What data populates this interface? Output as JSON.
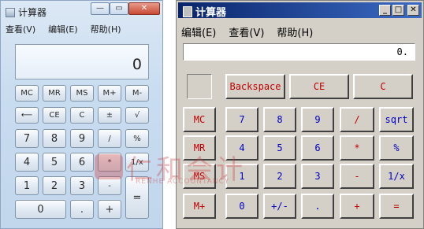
{
  "win7": {
    "title": "计算器",
    "controls": {
      "minimize": "—",
      "maximize": "▭",
      "close": "✕"
    },
    "menu": [
      "查看(V)",
      "编辑(E)",
      "帮助(H)"
    ],
    "display": "0",
    "buttons": [
      [
        "MC",
        "MR",
        "MS",
        "M+",
        "M-"
      ],
      [
        "⟵",
        "CE",
        "C",
        "±",
        "√"
      ],
      [
        "7",
        "8",
        "9",
        "/",
        "%"
      ],
      [
        "4",
        "5",
        "6",
        "*",
        "1/x"
      ],
      [
        "1",
        "2",
        "3",
        "-",
        "="
      ],
      [
        "0",
        ".",
        "+"
      ]
    ]
  },
  "classic": {
    "title": "计算器",
    "controls": {
      "minimize": "_",
      "maximize": "□",
      "close": "✕"
    },
    "menu": [
      "编辑(E)",
      "查看(V)",
      "帮助(H)"
    ],
    "display": "0.",
    "top_buttons": [
      "Backspace",
      "CE",
      "C"
    ],
    "rows": [
      [
        "MC",
        "7",
        "8",
        "9",
        "/",
        "sqrt"
      ],
      [
        "MR",
        "4",
        "5",
        "6",
        "*",
        "%"
      ],
      [
        "MS",
        "1",
        "2",
        "3",
        "-",
        "1/x"
      ],
      [
        "M+",
        "0",
        "+/-",
        ".",
        "+",
        "="
      ]
    ]
  },
  "watermark": {
    "text": "仁和会计",
    "sub": "RENHE ACCOUNTANCY"
  },
  "colors": {
    "classic_red": "#c00000",
    "classic_blue": "#0000c0",
    "title_blue": "#0a246a"
  }
}
